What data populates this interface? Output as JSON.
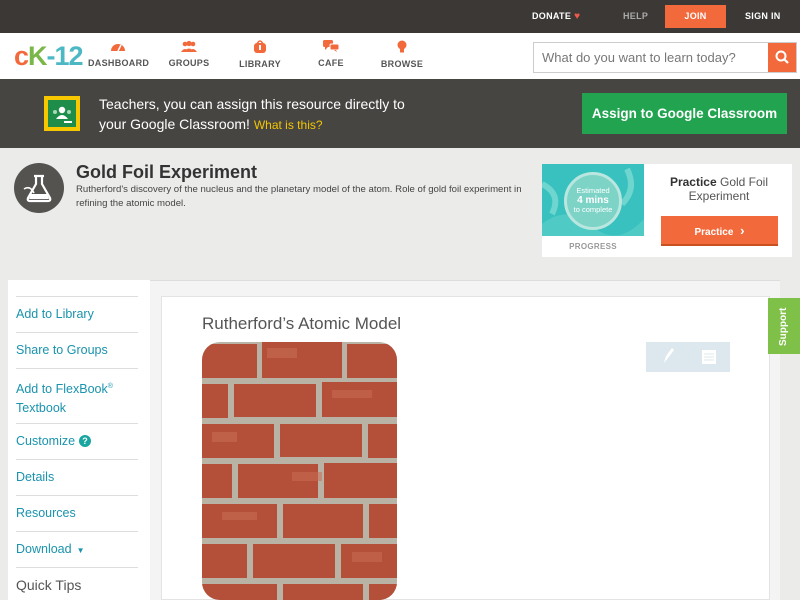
{
  "topbar": {
    "donate": "DONATE",
    "help": "HELP",
    "join": "JOIN",
    "signin": "SIGN IN"
  },
  "logo": {
    "c": "c",
    "k": "K",
    "n": "-12"
  },
  "nav": {
    "items": [
      {
        "label": "DASHBOARD",
        "icon": "dashboard-gauge-icon"
      },
      {
        "label": "GROUPS",
        "icon": "groups-people-icon"
      },
      {
        "label": "LIBRARY",
        "icon": "library-bag-icon"
      },
      {
        "label": "CAFE",
        "icon": "cafe-chat-icon"
      },
      {
        "label": "BROWSE",
        "icon": "browse-lightbulb-icon"
      }
    ],
    "search_placeholder": "What do you want to learn today?"
  },
  "banner": {
    "line1": "Teachers, you can assign this resource directly to",
    "line2": "your Google Classroom!",
    "whatis": "What is this?",
    "assign_label": "Assign to Google Classroom"
  },
  "concept": {
    "title": "Gold Foil Experiment",
    "description": "Rutherford's discovery of the nucleus and the planetary model of the atom. Role of gold foil experiment in refining the atomic model."
  },
  "practice": {
    "estimated": "Estimated",
    "mins": "4 mins",
    "to_complete": "to complete",
    "progress_label": "PROGRESS",
    "title_bold": "Practice",
    "title_rest": "Gold Foil Experiment",
    "button_label": "Practice"
  },
  "sidebar": {
    "add_library": "Add to Library",
    "share_groups": "Share to Groups",
    "add_flexbook": "Add to FlexBook",
    "reg": "®",
    "textbook": "Textbook",
    "customize": "Customize",
    "help_mark": "?",
    "details": "Details",
    "resources": "Resources",
    "download": "Download",
    "caret": "▼",
    "quick_tips": "Quick Tips"
  },
  "content": {
    "heading": "Rutherford’s Atomic Model"
  },
  "support": "Support",
  "colors": {
    "accent_orange": "#f26a3c",
    "link_teal": "#1a93ad",
    "google_green": "#21a350",
    "support_green": "#7fc148"
  }
}
